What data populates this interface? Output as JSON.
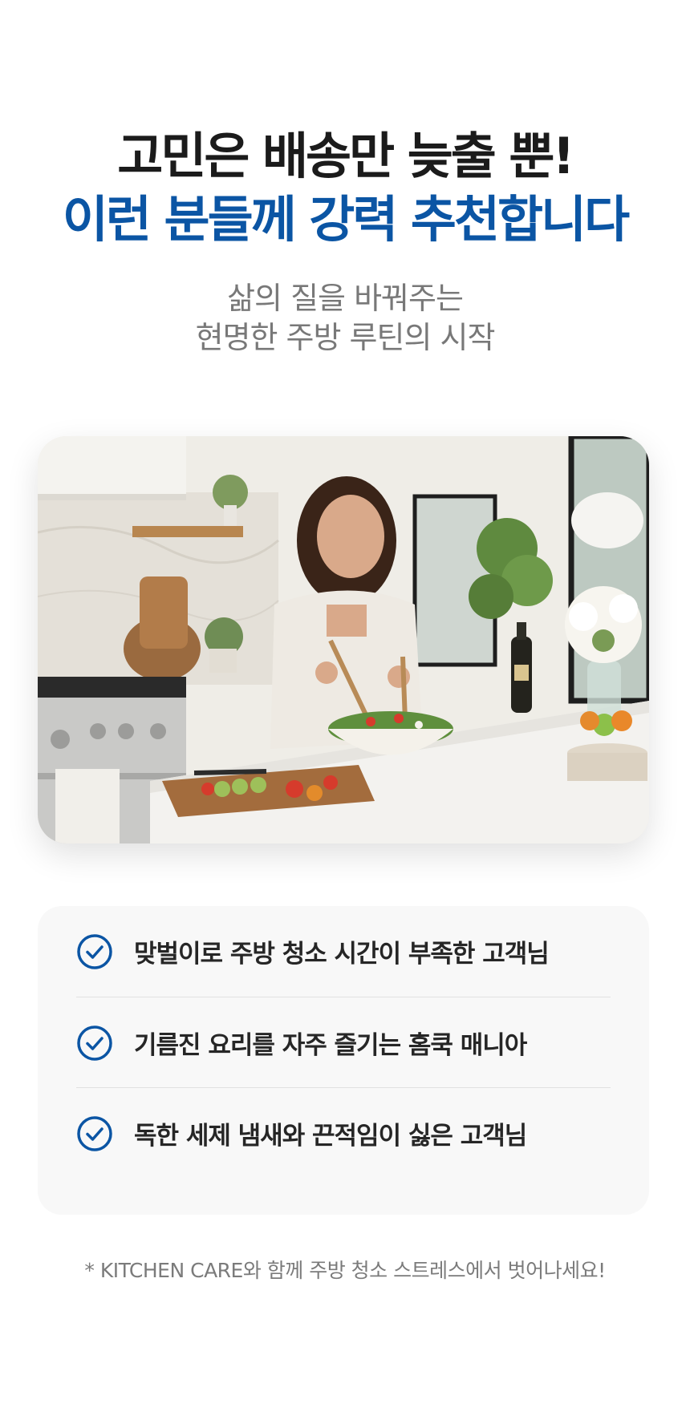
{
  "headline": {
    "line_1": "고민은 배송만 늦출 뿐!",
    "line_2": "이런 분들께 강력 추천합니다"
  },
  "subheadline": {
    "line_1": "삶의 질을 바꿔주는",
    "line_2": "현명한 주방 루틴의 시작"
  },
  "hero_image": {
    "scene": "kitchen-salad-photo"
  },
  "checklist": {
    "items": [
      {
        "icon": "check-circle-icon",
        "text": "맞벌이로 주방 청소 시간이 부족한 고객님"
      },
      {
        "icon": "check-circle-icon",
        "text": "기름진 요리를 자주 즐기는 홈쿡 매니아"
      },
      {
        "icon": "check-circle-icon",
        "text": "독한 세제 냄새와 끈적임이 싫은 고객님"
      }
    ]
  },
  "footnote": "* KITCHEN CARE와 함께 주방 청소 스트레스에서 벗어나세요!",
  "colors": {
    "accent_blue": "#0b55a4",
    "headline_dark": "#1b1b1b",
    "subtext_gray": "#787878",
    "card_bg": "#f8f8f8"
  }
}
